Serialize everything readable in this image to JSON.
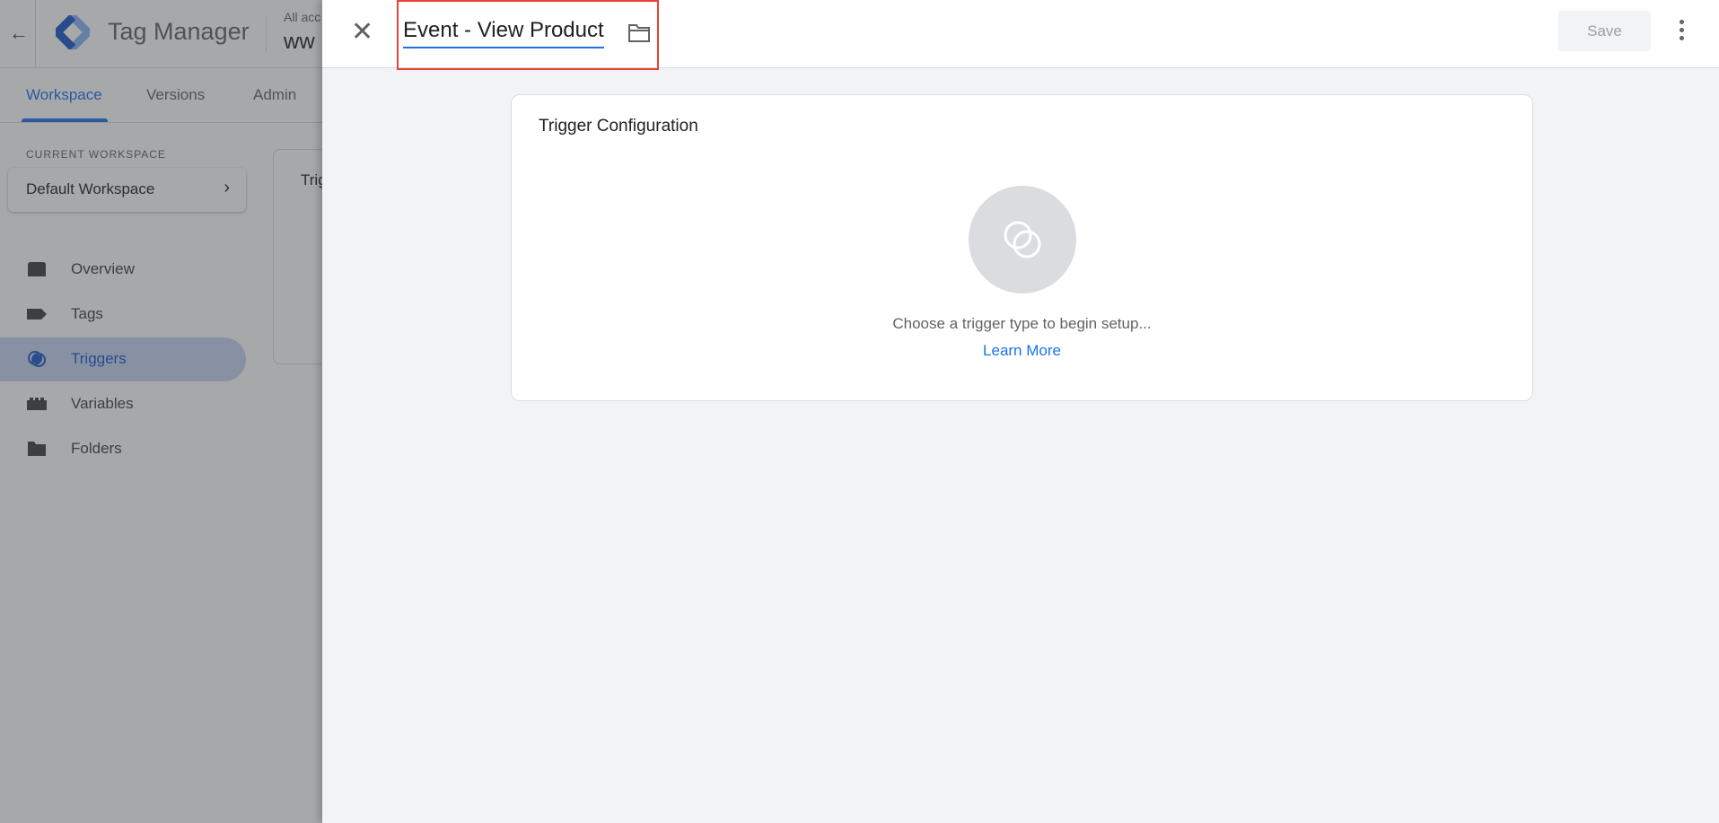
{
  "app": {
    "name": "Tag Manager",
    "account_label": "All acc",
    "container_label": "ww"
  },
  "tabs": [
    {
      "label": "Workspace",
      "active": true
    },
    {
      "label": "Versions"
    },
    {
      "label": "Admin"
    }
  ],
  "sidebar": {
    "section_label": "CURRENT WORKSPACE",
    "workspace": "Default Workspace",
    "items": [
      {
        "label": "Overview",
        "icon": "overview-icon"
      },
      {
        "label": "Tags",
        "icon": "tag-icon"
      },
      {
        "label": "Triggers",
        "icon": "trigger-icon",
        "active": true
      },
      {
        "label": "Variables",
        "icon": "variables-icon"
      },
      {
        "label": "Folders",
        "icon": "folder-icon"
      }
    ]
  },
  "background_card": {
    "title": "Trig"
  },
  "panel": {
    "title": "Event - View Product",
    "save_label": "Save",
    "card": {
      "title": "Trigger Configuration",
      "hint": "Choose a trigger type to begin setup...",
      "link": "Learn More"
    }
  },
  "colors": {
    "accent": "#1a73e8",
    "highlight": "#ea4335"
  }
}
